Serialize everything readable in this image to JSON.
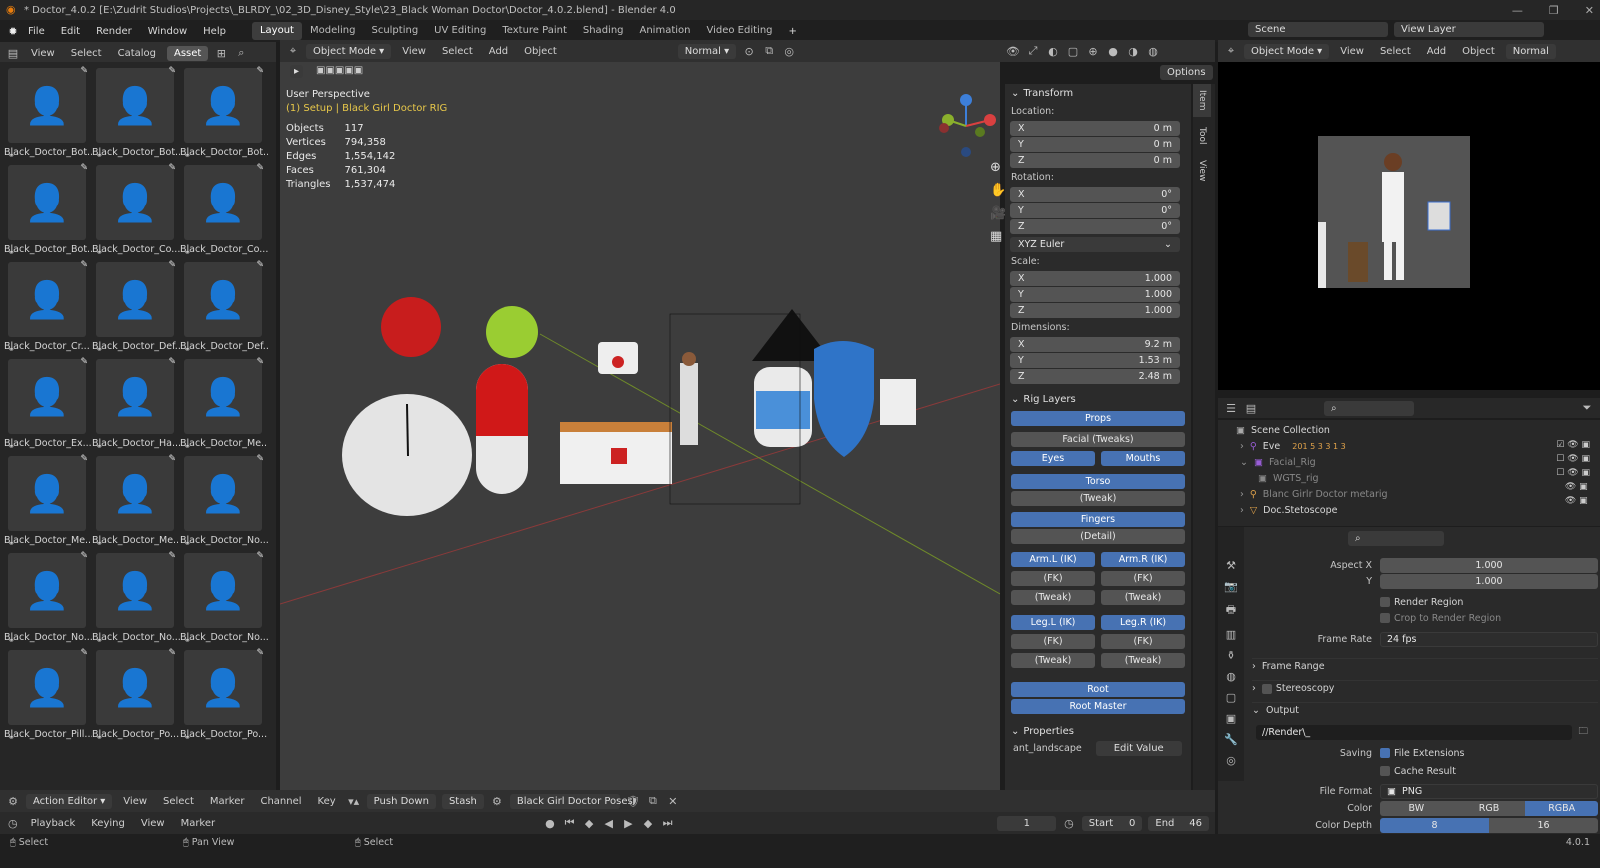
{
  "window": {
    "title": "* Doctor_4.0.2 [E:\\Zudrit Studios\\Projects\\_BLRDY_\\02_3D_Disney_Style\\23_Black Woman Doctor\\Doctor_4.0.2.blend] - Blender 4.0"
  },
  "menu": [
    "File",
    "Edit",
    "Render",
    "Window",
    "Help"
  ],
  "workspaces": [
    "Layout",
    "Modeling",
    "Sculpting",
    "UV Editing",
    "Texture Paint",
    "Shading",
    "Animation",
    "Video Editing"
  ],
  "active_workspace": "Layout",
  "scene": {
    "label": "Scene",
    "view_layer": "View Layer"
  },
  "asset_browser": {
    "menu": [
      "View",
      "Select",
      "Catalog",
      "Asset"
    ],
    "items": [
      "Black_Doctor_Bot...",
      "Black_Doctor_Bot...",
      "Black_Doctor_Bot...",
      "Black_Doctor_Bot...",
      "Black_Doctor_Co...",
      "Black_Doctor_Co...",
      "Black_Doctor_Cr...",
      "Black_Doctor_Def...",
      "Black_Doctor_Def...",
      "Black_Doctor_Ex...",
      "Black_Doctor_Ha...",
      "Black_Doctor_Me...",
      "Black_Doctor_Me...",
      "Black_Doctor_Me...",
      "Black_Doctor_No...",
      "Black_Doctor_No...",
      "Black_Doctor_No...",
      "Black_Doctor_No...",
      "Black_Doctor_Pill...",
      "Black_Doctor_Po...",
      "Black_Doctor_Po..."
    ]
  },
  "viewport": {
    "mode": "Object Mode",
    "menu": [
      "View",
      "Select",
      "Add",
      "Object"
    ],
    "orientation": "Normal",
    "options": "Options",
    "perspective": "User Perspective",
    "selection": "(1) Setup | Black Girl Doctor RIG",
    "stats": [
      {
        "label": "Objects",
        "value": "117"
      },
      {
        "label": "Vertices",
        "value": "794,358"
      },
      {
        "label": "Edges",
        "value": "1,554,142"
      },
      {
        "label": "Faces",
        "value": "761,304"
      },
      {
        "label": "Triangles",
        "value": "1,537,474"
      }
    ]
  },
  "npanel": {
    "tabs": [
      "Item",
      "Tool",
      "View"
    ],
    "transform_title": "Transform",
    "location_label": "Location:",
    "location": [
      {
        "axis": "X",
        "value": "0 m"
      },
      {
        "axis": "Y",
        "value": "0 m"
      },
      {
        "axis": "Z",
        "value": "0 m"
      }
    ],
    "rotation_label": "Rotation:",
    "rotation": [
      {
        "axis": "X",
        "value": "0°"
      },
      {
        "axis": "Y",
        "value": "0°"
      },
      {
        "axis": "Z",
        "value": "0°"
      }
    ],
    "rotation_mode": "XYZ Euler",
    "scale_label": "Scale:",
    "scale": [
      {
        "axis": "X",
        "value": "1.000"
      },
      {
        "axis": "Y",
        "value": "1.000"
      },
      {
        "axis": "Z",
        "value": "1.000"
      }
    ],
    "dimensions_label": "Dimensions:",
    "dimensions": [
      {
        "axis": "X",
        "value": "9.2 m"
      },
      {
        "axis": "Y",
        "value": "1.53 m"
      },
      {
        "axis": "Z",
        "value": "2.48 m"
      }
    ],
    "rig_title": "Rig Layers",
    "rig": {
      "props": "Props",
      "facial": "Facial (Tweaks)",
      "eyes": "Eyes",
      "mouths": "Mouths",
      "torso": "Torso",
      "torso_tweak": "(Tweak)",
      "fingers": "Fingers",
      "fingers_detail": "(Detail)",
      "arm_l_ik": "Arm.L (IK)",
      "arm_r_ik": "Arm.R (IK)",
      "fk": "(FK)",
      "tweak": "(Tweak)",
      "leg_l_ik": "Leg.L (IK)",
      "leg_r_ik": "Leg.R (IK)",
      "root": "Root",
      "root_master": "Root Master"
    },
    "properties_title": "Properties",
    "prop_name": "ant_landscape",
    "prop_button": "Edit Value"
  },
  "outliner": {
    "title": "Scene Collection",
    "items": [
      {
        "name": "Eve",
        "extra": "201  5  3  3  1  3"
      },
      {
        "name": "Facial_Rig",
        "extra": ""
      },
      {
        "name": "WGTS_rig",
        "extra": ""
      },
      {
        "name": "Blanc Girlr Doctor metarig",
        "extra": ""
      },
      {
        "name": "Doc.Stetoscope",
        "extra": ""
      }
    ]
  },
  "properties": {
    "aspect_x_label": "Aspect X",
    "aspect_x": "1.000",
    "aspect_y_label": "Y",
    "aspect_y": "1.000",
    "render_region": "Render Region",
    "crop": "Crop to Render Region",
    "frame_rate_label": "Frame Rate",
    "frame_rate": "24 fps",
    "frame_range": "Frame Range",
    "stereoscopy": "Stereoscopy",
    "output": "Output",
    "path": "//Render\\_",
    "saving_label": "Saving",
    "file_ext": "File Extensions",
    "cache": "Cache Result",
    "file_format_label": "File Format",
    "file_format": "PNG",
    "color_label": "Color",
    "color_opts": [
      "BW",
      "RGB",
      "RGBA"
    ],
    "depth_label": "Color Depth",
    "depth_opts": [
      "8",
      "16"
    ]
  },
  "action_editor": {
    "mode": "Action Editor",
    "menu": [
      "View",
      "Select",
      "Marker",
      "Channel",
      "Key"
    ],
    "push_down": "Push Down",
    "stash": "Stash",
    "action": "Black Girl Doctor Poses"
  },
  "playback": {
    "menu": [
      "Playback",
      "Keying",
      "View",
      "Marker"
    ],
    "frame": "1",
    "start_label": "Start",
    "start": "0",
    "end_label": "End",
    "end": "46"
  },
  "status": {
    "left": "Select",
    "middle": "Pan View",
    "right": "Select",
    "version": "4.0.1"
  },
  "colors": {
    "accent": "#4772b3",
    "viewport_bg": "#3d3d3d",
    "panel": "#2b2b2b"
  }
}
